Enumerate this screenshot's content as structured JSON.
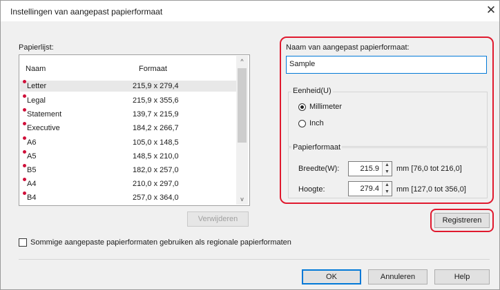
{
  "window": {
    "title": "Instellingen van aangepast papierformaat",
    "close_glyph": "✕"
  },
  "paper_list": {
    "label": "Papierlijst:",
    "columns": [
      "Naam",
      "Formaat"
    ],
    "items": [
      {
        "name": "Letter",
        "size": "215,9 x 279,4",
        "selected": true
      },
      {
        "name": "Legal",
        "size": "215,9 x 355,6"
      },
      {
        "name": "Statement",
        "size": "139,7 x 215,9"
      },
      {
        "name": "Executive",
        "size": "184,2 x 266,7"
      },
      {
        "name": "A6",
        "size": "105,0 x 148,5"
      },
      {
        "name": "A5",
        "size": "148,5 x 210,0"
      },
      {
        "name": "B5",
        "size": "182,0 x 257,0"
      },
      {
        "name": "A4",
        "size": "210,0 x 297,0"
      },
      {
        "name": "B4",
        "size": "257,0 x 364,0"
      }
    ],
    "scroll_up": "^",
    "scroll_down": "v"
  },
  "delete_button": "Verwijderen",
  "custom_name": {
    "label": "Naam van aangepast papierformaat:",
    "value": "Sample"
  },
  "unit": {
    "group_label": "Eenheid(U)",
    "options": [
      {
        "label": "Millimeter",
        "checked": true
      },
      {
        "label": "Inch",
        "checked": false
      }
    ]
  },
  "paper_size": {
    "group_label": "Papierformaat",
    "width": {
      "label": "Breedte(W):",
      "value": "215.9",
      "range": "mm [76,0 tot 216,0]"
    },
    "height": {
      "label": "Hoogte:",
      "value": "279.4",
      "range": "mm [127,0 tot 356,0]"
    }
  },
  "register_button": "Registreren",
  "regional_checkbox": {
    "label": "Sommige aangepaste papierformaten gebruiken als regionale papierformaten",
    "checked": false
  },
  "footer": {
    "ok": "OK",
    "cancel": "Annuleren",
    "help": "Help"
  },
  "colors": {
    "highlight": "#e0182d",
    "accent": "#0078d7",
    "marker": "#d0103a"
  }
}
